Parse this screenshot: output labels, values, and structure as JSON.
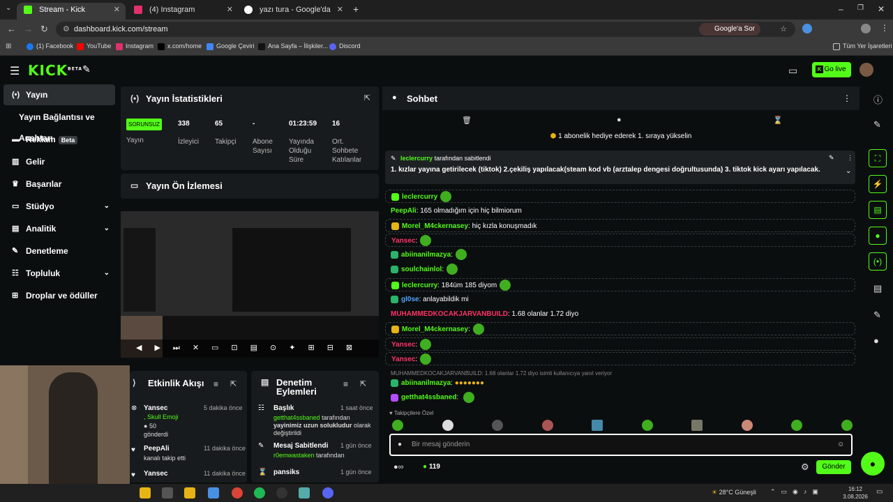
{
  "browser": {
    "tabs": [
      {
        "title": "Stream - Kick Dashboard",
        "active": true,
        "color": "#53fc18"
      },
      {
        "title": "(4) Instagram",
        "active": false,
        "color": "#e1306c"
      },
      {
        "title": "yazı tura - Google'da Ara",
        "active": false,
        "color": "#4285f4"
      }
    ],
    "url": "dashboard.kick.com/stream",
    "google_sor": "Google'a Sor",
    "bookmarks": [
      {
        "label": "(1) Facebook",
        "color": "#1877f2"
      },
      {
        "label": "YouTube",
        "color": "#ff0000"
      },
      {
        "label": "Instagram",
        "color": "#e1306c"
      },
      {
        "label": "x.com/home",
        "color": "#000000"
      },
      {
        "label": "Google Çeviri",
        "color": "#4285f4"
      },
      {
        "label": "Ana Sayfa – İlişkiler...",
        "color": "#111111"
      },
      {
        "label": "Discord",
        "color": "#5865f2"
      }
    ],
    "all_bookmarks": "Tüm Yer İşaretleri"
  },
  "header": {
    "logo": "KICK",
    "logo_sup": "BETA",
    "go_live": "Go live"
  },
  "sidebar": {
    "items": [
      {
        "label": "Yayın",
        "icon": "(•)"
      },
      {
        "label": "Yayın Bağlantısı ve Anahtarı",
        "icon": ""
      },
      {
        "label": "Reklam",
        "icon": "▬",
        "beta": "Beta"
      },
      {
        "label": "Gelir",
        "icon": "▥"
      },
      {
        "label": "Başarılar",
        "icon": "🏆"
      },
      {
        "label": "Stüdyo",
        "icon": "▭"
      },
      {
        "label": "Analitik",
        "icon": "📊"
      },
      {
        "label": "Denetleme",
        "icon": "✎"
      },
      {
        "label": "Topluluk",
        "icon": "☷"
      },
      {
        "label": "Droplar ve ödüller",
        "icon": "⊞"
      }
    ]
  },
  "stats_panel": {
    "title": "Yayın İstatistikleri",
    "badge": "SORUNSUZ",
    "badge_label": "Yayın",
    "stats": [
      {
        "value": "338",
        "label": "İzleyici"
      },
      {
        "value": "65",
        "label": "Takipçi"
      },
      {
        "value": "-",
        "label": "Abone Sayısı"
      },
      {
        "value": "01:23:59",
        "label": "Yayında Olduğu Süre"
      },
      {
        "value": "16",
        "label": "Ort. Sohbete Katılanlar"
      }
    ]
  },
  "preview_panel": {
    "title": "Yayın Ön İzlemesi"
  },
  "activity_panel": {
    "title": "Etkinlik Akışı",
    "items": [
      {
        "user": "Yansec",
        "time": "5 dakika önce",
        "detail_user": "Skull Emoji",
        "amount": "50",
        "action": "gönderdi"
      },
      {
        "user": "PeepAli",
        "time": "11 dakika önce",
        "action": "kanalı takip etti"
      },
      {
        "user": "Yansec",
        "time": "11 dakika önce"
      }
    ]
  },
  "moderation_panel": {
    "title": "Denetim Eylemleri",
    "items": [
      {
        "title": "Başlık",
        "time": "1 saat önce",
        "user": "getthat4ssbaned",
        "text": "tarafından",
        "detail": "yayinimiz uzun solukludur",
        "suffix": "olarak değiştirildi"
      },
      {
        "title": "Mesaj Sabitlendi",
        "time": "1 gün önce",
        "user": "r0emwastaken",
        "text": "tarafından"
      },
      {
        "title": "pansiks",
        "time": "1 gün önce"
      }
    ]
  },
  "chat": {
    "title": "Sohbet",
    "gift_banner": "1 abonelik hediye ederek 1. sıraya yükselin",
    "pinned_by": "leclercurry",
    "pinned_by_suffix": "tarafından sabitlendi",
    "pinned_text": "1. kızlar yayına getirilecek (tiktok) 2.çekiliş yapılacak(steam kod vb (arztalep dengesi doğrultusunda) 3. tiktok kick ayarı yapılacak.",
    "messages": [
      {
        "user": "leclercurry",
        "color": "#53fc18",
        "text": "",
        "emote": true,
        "boxed": true,
        "badge": "#53fc18"
      },
      {
        "user": "PeepAli",
        "color": "#53fc18",
        "text": ": 165 olmadığım için hiç bilmiorum",
        "emote": false,
        "boxed": false,
        "badge": ""
      },
      {
        "user": "Morel_M4ckernasey",
        "color": "#53fc18",
        "text": ": hiç kızla konuşmadık",
        "emote": false,
        "boxed": true,
        "badge": "#e7b416"
      },
      {
        "user": "Yansec",
        "color": "#ff3366",
        "text": ":",
        "emote": true,
        "boxed": true,
        "badge": ""
      },
      {
        "user": "abiinanilmazya",
        "color": "#53fc18",
        "text": ":",
        "emote": true,
        "boxed": false,
        "badge": "#2ab36a"
      },
      {
        "user": "soulchainlol",
        "color": "#53fc18",
        "text": ":",
        "emote": true,
        "boxed": false,
        "badge": "#2ab36a"
      },
      {
        "user": "leclercurry",
        "color": "#53fc18",
        "text": ": 184üm 185 diyom",
        "emote": true,
        "boxed": true,
        "badge": "#53fc18"
      },
      {
        "user": "gl0se",
        "color": "#4da6ff",
        "text": ": anlayabildik mi",
        "emote": false,
        "boxed": false,
        "badge": "#2ab36a"
      },
      {
        "user": "MUHAMMEDKOCAKJARVANBUILD",
        "color": "#ff3366",
        "text": ": 1.68 olanlar 1.72 diyo",
        "emote": false,
        "boxed": false,
        "badge": ""
      },
      {
        "user": "Morel_M4ckernasey",
        "color": "#53fc18",
        "text": ":",
        "emote": true,
        "boxed": true,
        "badge": "#e7b416"
      },
      {
        "user": "Yansec",
        "color": "#ff3366",
        "text": ":",
        "emote": true,
        "boxed": true,
        "badge": ""
      },
      {
        "user": "Yansec",
        "color": "#ff3366",
        "text": ":",
        "emote": true,
        "boxed": true,
        "badge": ""
      }
    ],
    "reply_note": "MUHAMMEDKOCAKJARVANBUILD: 1.68 olanlar 1.72 diyo isimli kullanıcıya yanıt veriyor",
    "reply_user": "abiinanilmazya",
    "last_user": "getthat4ssbaned",
    "followers_only": "Takipçilere Özel",
    "input_placeholder": "Bir mesaj gönderin",
    "viewers": "119",
    "send": "Gönder"
  },
  "taskbar": {
    "weather": "28°C  Güneşli",
    "time": "16:12",
    "date": "3.08.2026"
  }
}
